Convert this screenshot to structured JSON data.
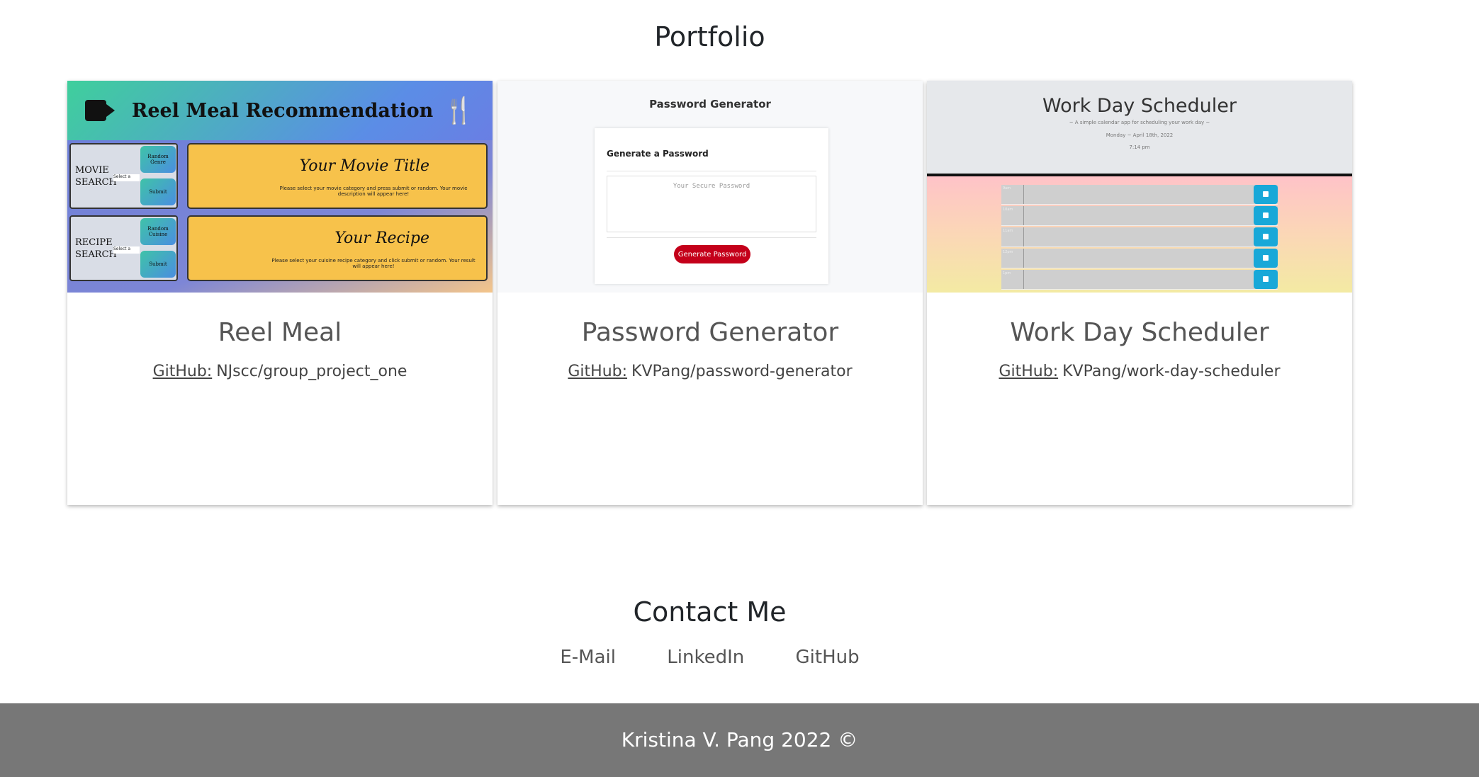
{
  "portfolio": {
    "title": "Portfolio",
    "projects": [
      {
        "title": "Reel Meal",
        "github_label": "GitHub:",
        "repo": "NJscc/group_project_one",
        "thumbnail": {
          "header": "Reel Meal Recommendation",
          "movie_label": "MOVIE SEARCH",
          "recipe_label": "RECIPE SEARCH",
          "select_text": "Select a",
          "random_genre": "Random Genre",
          "random_cuisine": "Random Cuisine",
          "submit": "Submit",
          "movie_title": "Your Movie Title",
          "movie_desc": "Please select your movie category and press submit or random. Your movie description will appear here!",
          "recipe_title": "Your Recipe",
          "recipe_desc": "Please select your cuisine recipe category and click submit or random. Your result will appear here!"
        }
      },
      {
        "title": "Password Generator",
        "github_label": "GitHub:",
        "repo": "KVPang/password-generator",
        "thumbnail": {
          "header": "Password Generator",
          "card_title": "Generate a Password",
          "placeholder": "Your Secure Password",
          "button": "Generate Password"
        }
      },
      {
        "title": "Work Day Scheduler",
        "github_label": "GitHub:",
        "repo": "KVPang/work-day-scheduler",
        "thumbnail": {
          "header": "Work Day Scheduler",
          "tagline": "~ A simple calendar app for scheduling your work day ~",
          "date": "Monday ~ April 18th, 2022",
          "time": "7:14 pm",
          "hours": [
            "9am",
            "10am",
            "11am",
            "12pm",
            "1pm"
          ]
        }
      }
    ]
  },
  "contact": {
    "title": "Contact Me",
    "links": [
      "E-Mail",
      "LinkedIn",
      "GitHub"
    ]
  },
  "footer": {
    "text": "Kristina V. Pang 2022 ©"
  },
  "colors": {
    "footer_bg": "#777777",
    "password_button": "#c4001a",
    "save_button": "#18a8d8",
    "reel_panel": "#f7c24b"
  }
}
